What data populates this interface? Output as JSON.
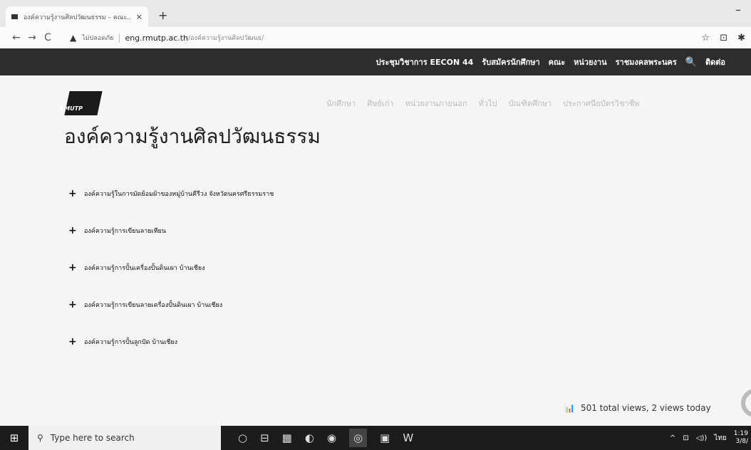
{
  "browser": {
    "tab_title": "องค์ความรู้งานศิลปวัฒนธรรม – คณะ...",
    "tab_close": "×",
    "new_tab": "+",
    "minimize": "–",
    "nav_back": "←",
    "nav_forward": "→",
    "nav_reload": "C",
    "warning_icon": "▲",
    "security_text": "ไม่ปลอดภัย",
    "url_host": "eng.rmutp.ac.th",
    "url_path": "/องค์ความรู้งานศิลปวัฒนธ/",
    "star_icon": "☆",
    "ext_icon": "⊡",
    "pin_icon": "✱"
  },
  "site_nav": {
    "items": [
      "ประชุมวิชาการ EECON 44",
      "รับสมัครนักศึกษา",
      "คณะ",
      "หน่วยงาน",
      "ราชมงคลพระนคร"
    ],
    "search_icon": "🔍",
    "contact": "ติดต่อ"
  },
  "logo": {
    "text": "RMUTP"
  },
  "sub_nav": {
    "items": [
      "นักศึกษา",
      "ศิษย์เก่า",
      "หน่วยงานภายนอก",
      "ทั่วไป",
      "บัณฑิตศึกษา",
      "ประกาศนียบัตรวิชาชีพ"
    ]
  },
  "page": {
    "title": "องค์ความรู้งานศิลปวัฒนธรรม",
    "accordion_icon": "+",
    "items": [
      "องค์ความรู้ในการมัดย้อมผ้าของหมู่บ้านคีรีวง จังหวัดนครศรีธรรมราช",
      "องค์ความรู้การเขียนลายเทียน",
      "องค์ความรู้การปั้นเครื่องปั้นดินเผา บ้านเชียง",
      "องค์ความรู้การเขียนลายเครื่องปั้นดินเผา บ้านเชียง",
      "องค์ความรู้การปั้นลูกปัด บ้านเชียง"
    ]
  },
  "views": {
    "chart_icon": "📊",
    "text": "501 total views,  2 views today"
  },
  "taskbar": {
    "start_icon": "⊞",
    "search_icon": "⚲",
    "search_placeholder": "Type here to search",
    "apps": [
      "○",
      "⊟",
      "▦",
      "◐",
      "◉",
      "◎",
      "▣",
      "W"
    ],
    "tray_up": "^",
    "tray_net": "⊡",
    "tray_vol": "◁))",
    "lang": "ไทย",
    "time": "1:19",
    "date": "3/8/"
  }
}
